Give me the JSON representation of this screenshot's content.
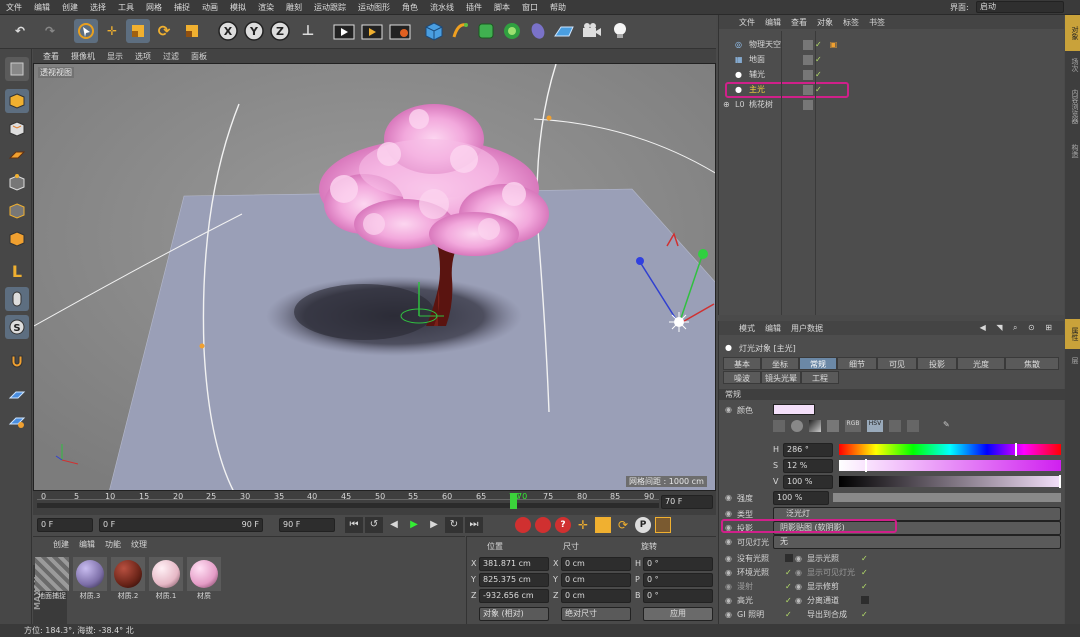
{
  "menu": [
    "文件",
    "编辑",
    "创建",
    "选择",
    "工具",
    "网格",
    "捕捉",
    "动画",
    "模拟",
    "渲染",
    "雕刻",
    "运动跟踪",
    "运动图形",
    "角色",
    "流水线",
    "插件",
    "脚本",
    "窗口",
    "帮助"
  ],
  "interface_label": "界面:",
  "interface_value": "启动",
  "viewport": {
    "menu": [
      "查看",
      "摄像机",
      "显示",
      "选项",
      "过滤",
      "面板"
    ],
    "name": "透视视图",
    "grid_info": "网格间距 : 1000 cm"
  },
  "timeline": {
    "ticks": [
      "0",
      "5",
      "10",
      "15",
      "20",
      "25",
      "30",
      "35",
      "40",
      "45",
      "50",
      "55",
      "60",
      "65",
      "70",
      "75",
      "80",
      "85",
      "90"
    ],
    "current_frame": "70",
    "end_field": "70 F"
  },
  "transport": {
    "start": "0 F",
    "range_start": "0 F",
    "range_end": "90 F",
    "end": "90 F"
  },
  "materials": {
    "menu": [
      "创建",
      "编辑",
      "功能",
      "纹理"
    ],
    "items": [
      {
        "name": "地面捕捉",
        "color": "#8a8a8a"
      },
      {
        "name": "材质.3",
        "color": "#7d6fa8"
      },
      {
        "name": "材质.2",
        "color": "#6a2418"
      },
      {
        "name": "材质.1",
        "color": "#e6b8c6"
      },
      {
        "name": "材质",
        "color": "#e49cc6"
      }
    ]
  },
  "coords": {
    "headers": [
      "位置",
      "尺寸",
      "旋转"
    ],
    "rows": [
      {
        "axis": "X",
        "pos": "381.871 cm",
        "saxis": "X",
        "size": "0 cm",
        "raxis": "H",
        "rot": "0 °"
      },
      {
        "axis": "Y",
        "pos": "825.375 cm",
        "saxis": "Y",
        "size": "0 cm",
        "raxis": "P",
        "rot": "0 °"
      },
      {
        "axis": "Z",
        "pos": "-932.656 cm",
        "saxis": "Z",
        "size": "0 cm",
        "raxis": "B",
        "rot": "0 °"
      }
    ],
    "mode": "对象 (相对)",
    "size_mode": "绝对尺寸",
    "apply": "应用"
  },
  "status": "方位: 184.3°, 海拔: -38.4° 北",
  "object_manager": {
    "menu": [
      "文件",
      "编辑",
      "查看",
      "对象",
      "标签",
      "书签"
    ],
    "objects": [
      {
        "name": "物理天空",
        "selected": false
      },
      {
        "name": "地面",
        "selected": false
      },
      {
        "name": "辅光",
        "selected": false
      },
      {
        "name": "主光",
        "selected": true
      },
      {
        "name": "桃花树",
        "selected": false
      }
    ]
  },
  "attributes": {
    "menu": [
      "模式",
      "编辑",
      "用户数据"
    ],
    "title": "灯光对象 [主光]",
    "tabs_row1": [
      "基本",
      "坐标",
      "常规",
      "细节",
      "可见",
      "投影",
      "光度",
      "焦散"
    ],
    "tabs_row2": [
      "噪波",
      "镜头光晕",
      "工程"
    ],
    "active_tab": "常规",
    "section": "常规",
    "color_label": "颜色",
    "h_label": "H",
    "h_value": "286 °",
    "s_label": "S",
    "s_value": "12 %",
    "v_label": "V",
    "v_value": "100 %",
    "intensity_label": "强度",
    "intensity_value": "100 %",
    "type_label": "类型",
    "type_value": "泛光灯",
    "shadow_label": "投影",
    "shadow_value": "阴影贴图 (软阴影)",
    "visible_label": "可见灯光",
    "visible_value": "无",
    "opts_left": [
      "没有光照",
      "环境光照",
      "漫射",
      "高光",
      "GI 照明"
    ],
    "opts_right": [
      "显示光照",
      "显示可见灯光",
      "显示修剪",
      "分离通道",
      "导出到合成"
    ],
    "color_swatch": "#f4e0fa"
  },
  "side_tabs": [
    "对象",
    "场次",
    "内容浏览器",
    "构造",
    "属性",
    "层"
  ]
}
